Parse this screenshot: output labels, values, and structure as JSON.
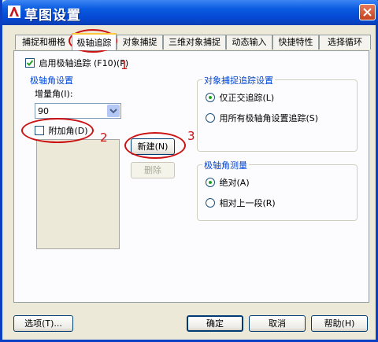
{
  "window": {
    "title": "草图设置",
    "app_icon": "autocad-a-icon",
    "close_icon": "close-x-icon"
  },
  "tabs": [
    "捕捉和栅格",
    "极轴追踪",
    "对象捕捉",
    "三维对象捕捉",
    "动态输入",
    "快捷特性",
    "选择循环"
  ],
  "active_tab": "极轴追踪",
  "enable_polar": {
    "label": "启用极轴追踪 (F10)(P)",
    "checked": true
  },
  "polar_angle_group": {
    "title": "极轴角设置",
    "increment_label": "增量角(I):",
    "increment_value": "90",
    "additional_label": "附加角(D)",
    "additional_checked": false,
    "new_button": "新建(N)",
    "delete_button": "删除"
  },
  "object_snap_tracking": {
    "title": "对象捕捉追踪设置",
    "options": [
      "仅正交追踪(L)",
      "用所有极轴角设置追踪(S)"
    ],
    "selected": 0
  },
  "polar_angle_measurement": {
    "title": "极轴角测量",
    "options": [
      "绝对(A)",
      "相对上一段(R)"
    ],
    "selected": 0
  },
  "footer": {
    "options_button": "选项(T)...",
    "ok_button": "确定",
    "cancel_button": "取消",
    "help_button": "帮助(H)"
  },
  "annotations": [
    "1",
    "2",
    "3"
  ],
  "colors": {
    "title_bar": "#0a5be0",
    "annotation": "#cc1111",
    "group_title": "#0046d5"
  }
}
